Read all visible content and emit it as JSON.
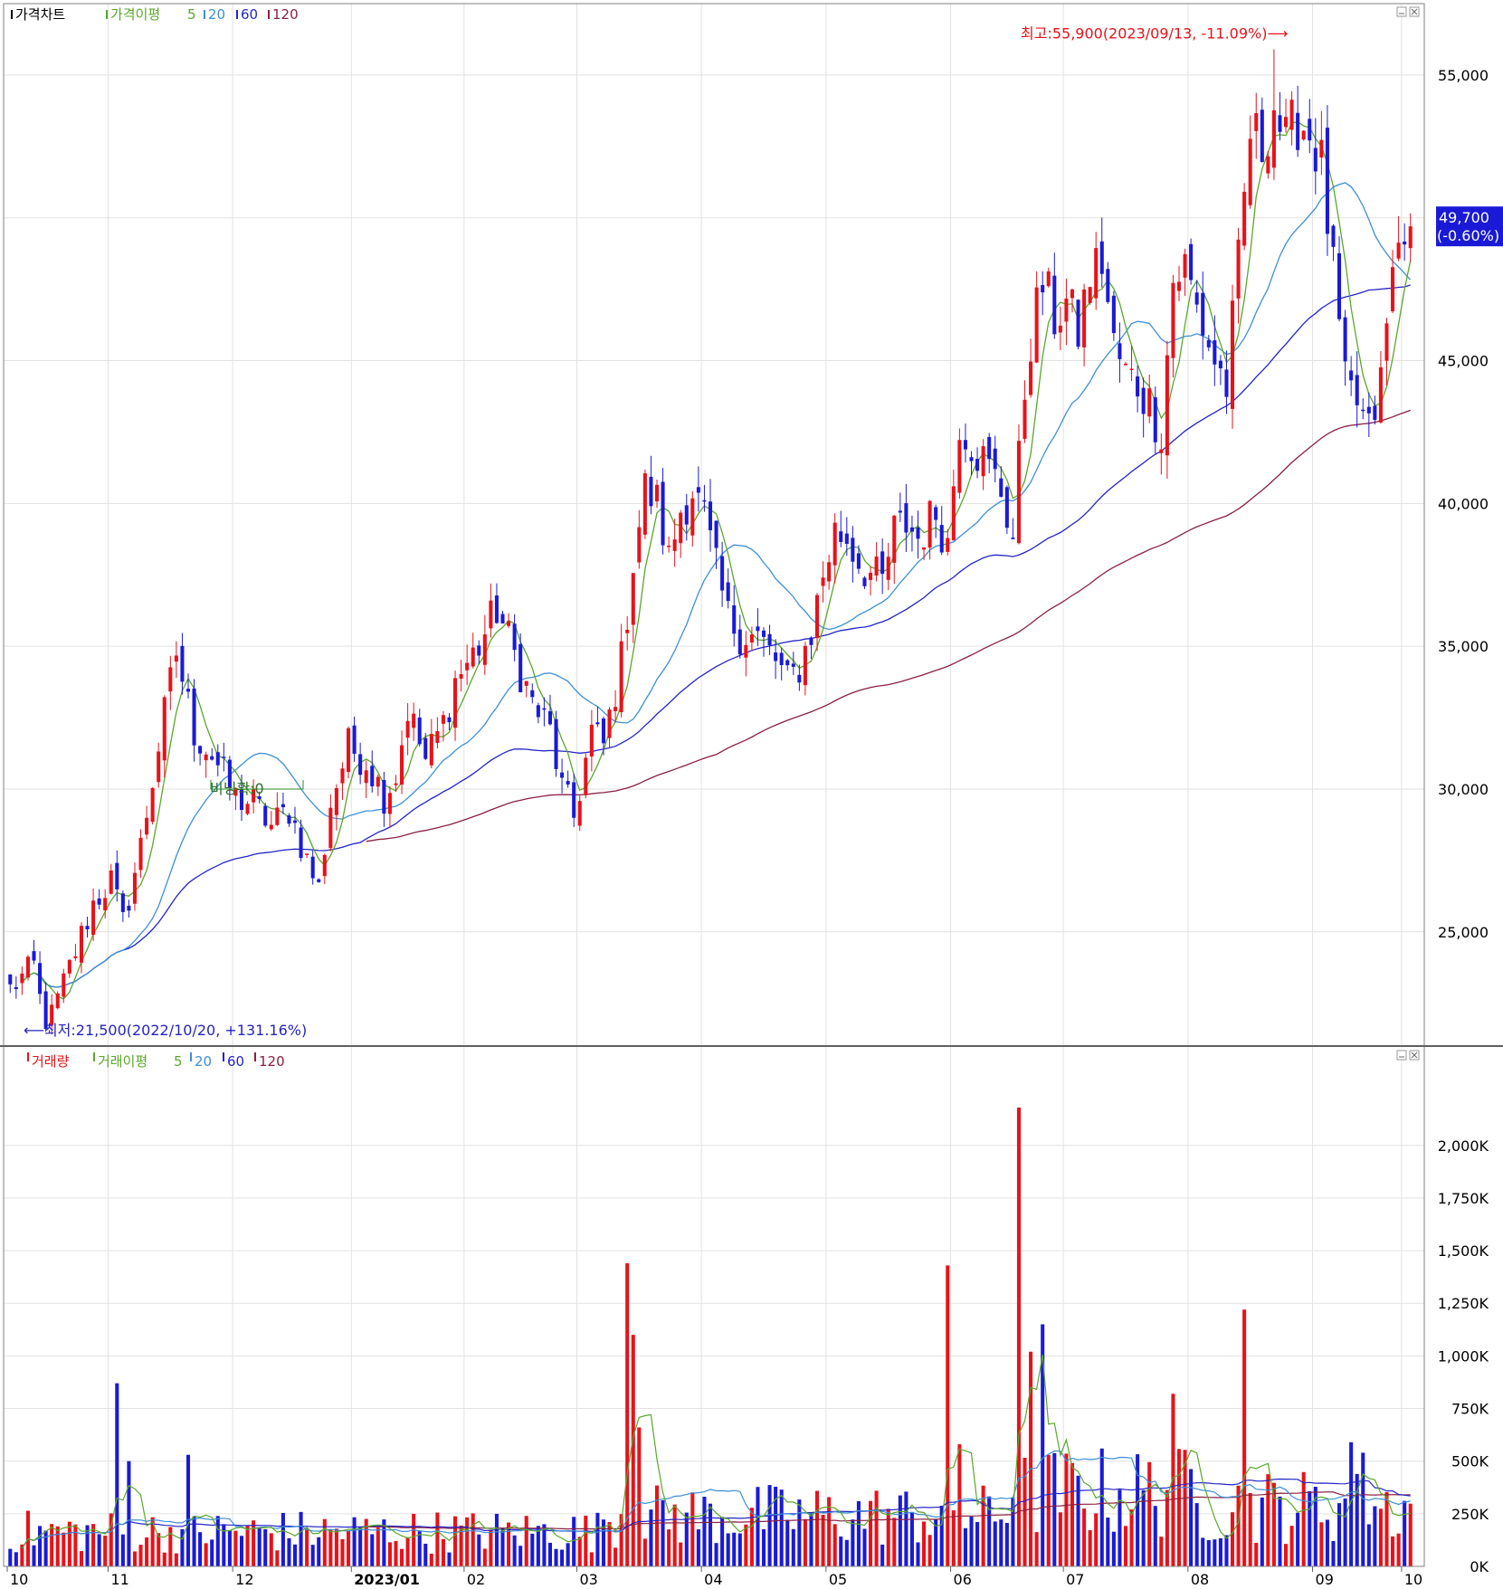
{
  "chart_data": {
    "type": "candlestick",
    "price_panel": {
      "legend": {
        "title": "가격차트",
        "ma_label": "가격이평",
        "ma_periods": [
          "5",
          "20",
          "60",
          "120"
        ]
      },
      "ylim": [
        21000,
        57500
      ],
      "y_ticks": [
        25000,
        30000,
        35000,
        40000,
        45000,
        50000,
        55000
      ],
      "y_tick_labels": [
        "25,000",
        "30,000",
        "35,000",
        "40,000",
        "45,000",
        "50,000",
        "55,000"
      ],
      "current_price": {
        "value": 49700,
        "label": "49,700",
        "change_label": "(-0.60%)"
      },
      "annotations": {
        "high": {
          "value": 55900,
          "label": "최고:55,900(2023/09/13, -11.09%)⟶"
        },
        "low": {
          "value": 21500,
          "label": "⟵최저:21,500(2022/10/20, +131.16%)"
        },
        "split": {
          "label": "비닝확:0"
        }
      }
    },
    "volume_panel": {
      "legend": {
        "title": "거래량",
        "ma_label": "거래이평",
        "ma_periods": [
          "5",
          "20",
          "60",
          "120"
        ]
      },
      "ylim": [
        0,
        2300
      ],
      "y_ticks": [
        0,
        250,
        500,
        750,
        1000,
        1250,
        1500,
        1750,
        2000
      ],
      "y_tick_labels": [
        "0K",
        "250K",
        "500K",
        "750K",
        "1,000K",
        "1,250K",
        "1,500K",
        "1,750K",
        "2,000K"
      ],
      "unit": "K"
    },
    "x_axis": {
      "labels": [
        "10",
        "11",
        "12",
        "2023/01",
        "02",
        "03",
        "04",
        "05",
        "06",
        "07",
        "08",
        "09",
        "10"
      ]
    },
    "colors": {
      "up": "#e8121a",
      "down": "#1a1ad6",
      "ma5": "#5aa82a",
      "ma20": "#3d8fd8",
      "ma60": "#2424c8",
      "ma120": "#8a2040",
      "grid": "#e2e2e2",
      "panel_border": "#808080",
      "annotation": "#e8121a"
    },
    "price_path": [
      [
        0,
        23000
      ],
      [
        4,
        23800
      ],
      [
        6,
        21500
      ],
      [
        9,
        23200
      ],
      [
        14,
        26000
      ],
      [
        17,
        26800
      ],
      [
        19,
        25300
      ],
      [
        22,
        28000
      ],
      [
        25,
        31500
      ],
      [
        28,
        34800
      ],
      [
        31,
        32000
      ],
      [
        34,
        31200
      ],
      [
        38,
        29700
      ],
      [
        41,
        29500
      ],
      [
        44,
        28700
      ],
      [
        47,
        29300
      ],
      [
        50,
        27500
      ],
      [
        52,
        26500
      ],
      [
        54,
        29500
      ],
      [
        57,
        31500
      ],
      [
        60,
        31000
      ],
      [
        63,
        29800
      ],
      [
        65,
        30500
      ],
      [
        67,
        32800
      ],
      [
        70,
        31000
      ],
      [
        73,
        32300
      ],
      [
        75,
        33800
      ],
      [
        79,
        35000
      ],
      [
        82,
        36300
      ],
      [
        85,
        34700
      ],
      [
        88,
        33000
      ],
      [
        91,
        32000
      ],
      [
        93,
        30000
      ],
      [
        95,
        29000
      ],
      [
        98,
        32000
      ],
      [
        100,
        31500
      ],
      [
        103,
        34500
      ],
      [
        105,
        38000
      ],
      [
        107,
        40500
      ],
      [
        109,
        40000
      ],
      [
        111,
        38000
      ],
      [
        113,
        39800
      ],
      [
        115,
        40500
      ],
      [
        117,
        39500
      ],
      [
        119,
        37600
      ],
      [
        121,
        36000
      ],
      [
        123,
        35500
      ],
      [
        126,
        35300
      ],
      [
        129,
        34500
      ],
      [
        131,
        33700
      ],
      [
        133,
        34300
      ],
      [
        135,
        35500
      ],
      [
        137,
        37500
      ],
      [
        139,
        39000
      ],
      [
        141,
        38800
      ],
      [
        143,
        38000
      ],
      [
        145,
        37500
      ],
      [
        147,
        37200
      ],
      [
        149,
        39000
      ],
      [
        151,
        39300
      ],
      [
        153,
        38800
      ],
      [
        156,
        39700
      ],
      [
        158,
        38600
      ],
      [
        160,
        43000
      ],
      [
        162,
        42200
      ],
      [
        164,
        41500
      ],
      [
        167,
        40500
      ],
      [
        169,
        38800
      ],
      [
        171,
        44000
      ],
      [
        172,
        45800
      ],
      [
        174,
        47700
      ],
      [
        176,
        46500
      ],
      [
        178,
        47000
      ],
      [
        180,
        46000
      ],
      [
        182,
        48000
      ],
      [
        184,
        48500
      ],
      [
        186,
        45500
      ],
      [
        188,
        44500
      ],
      [
        190,
        44200
      ],
      [
        192,
        43500
      ],
      [
        194,
        42600
      ],
      [
        196,
        47800
      ],
      [
        198,
        48300
      ],
      [
        200,
        46800
      ],
      [
        203,
        45000
      ],
      [
        205,
        44100
      ],
      [
        207,
        48300
      ],
      [
        209,
        53000
      ],
      [
        211,
        52500
      ],
      [
        213,
        54000
      ],
      [
        215,
        52500
      ],
      [
        217,
        53500
      ],
      [
        219,
        53000
      ],
      [
        221,
        51800
      ],
      [
        223,
        48000
      ],
      [
        225,
        44000
      ],
      [
        227,
        43500
      ],
      [
        229,
        42400
      ],
      [
        231,
        44200
      ],
      [
        233,
        48000
      ],
      [
        235,
        50000
      ],
      [
        236,
        49700
      ]
    ],
    "volume_spikes": [
      [
        18,
        870
      ],
      [
        20,
        500
      ],
      [
        30,
        530
      ],
      [
        104,
        1440
      ],
      [
        105,
        1100
      ],
      [
        106,
        660
      ],
      [
        158,
        1430
      ],
      [
        160,
        580
      ],
      [
        170,
        2180
      ],
      [
        172,
        1020
      ],
      [
        174,
        1150
      ],
      [
        196,
        820
      ],
      [
        208,
        1220
      ],
      [
        226,
        590
      ],
      [
        228,
        540
      ]
    ]
  }
}
